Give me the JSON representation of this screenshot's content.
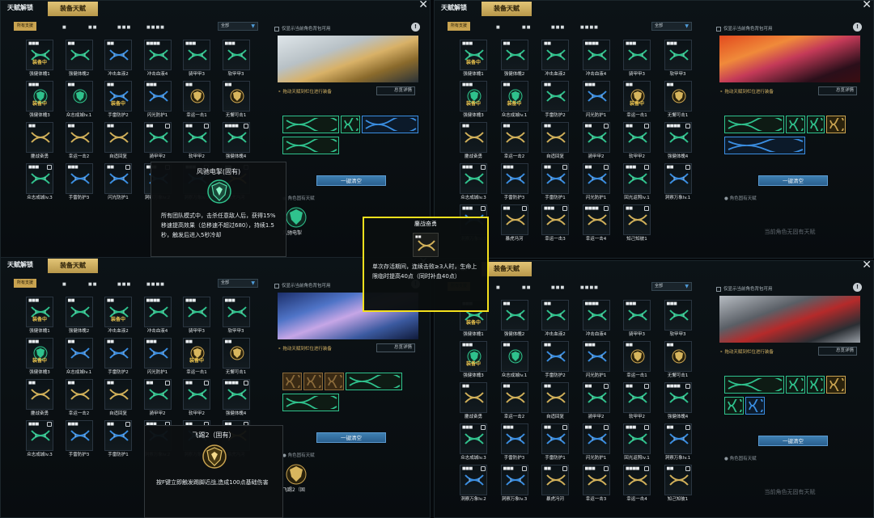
{
  "colors": {
    "accent_gold": "#c9a350",
    "equip_yellow": "#e7c04d",
    "helix_green": "#2fc28d",
    "helix_blue": "#3a8ee2",
    "highlight_box": "#f4e01d"
  },
  "common": {
    "tab_talent": "天赋解锁",
    "tab_equip": "装备天赋",
    "filter_all": "所有支援",
    "dropdown_value": "全部",
    "only_show_label": "仅显示当前角色背包可用",
    "help_glyph": "!",
    "drag_hint": "拖动天赋到栏位进行装备",
    "detail_button": "总览详情",
    "clear_button": "一键清空",
    "innate_title": "角色固有天赋",
    "innate_empty": "当前角色无固有天赋",
    "equipped_badge": "装备中",
    "close_glyph": "✕"
  },
  "panels": [
    {
      "cells": [
        {
          "label": "强健体魄1",
          "icon": "helix-green",
          "dots": "■■■",
          "equipped": true,
          "lock": false
        },
        {
          "label": "强健体魄2",
          "icon": "helix-green",
          "dots": "■■",
          "equipped": false,
          "lock": false
        },
        {
          "label": "冲击血液2",
          "icon": "helix-blue",
          "dots": "■■",
          "equipped": false,
          "lock": false
        },
        {
          "label": "冲击血液4",
          "icon": "helix-green",
          "dots": "■■■■",
          "equipped": false,
          "lock": false
        },
        {
          "label": "骑甲甲3",
          "icon": "helix-green",
          "dots": "■■■",
          "equipped": false,
          "lock": false
        },
        {
          "label": "软甲甲3",
          "icon": "helix-green",
          "dots": "■■■",
          "equipped": false,
          "lock": false
        },
        {
          "label": "强健体魄3",
          "icon": "shield-green",
          "dots": "■■■",
          "equipped": true,
          "lock": false
        },
        {
          "label": "众志成城lv.1",
          "icon": "shield-green",
          "dots": "■■",
          "equipped": false,
          "lock": false
        },
        {
          "label": "手雷防护2",
          "icon": "helix-blue",
          "dots": "■■",
          "equipped": true,
          "lock": false
        },
        {
          "label": "闪光防护1",
          "icon": "helix-blue",
          "dots": "■■■",
          "equipped": false,
          "lock": false
        },
        {
          "label": "幸运一击1",
          "icon": "shield-gold",
          "dots": "■■",
          "equipped": false,
          "lock": false
        },
        {
          "label": "无懈可击1",
          "icon": "shield-gold",
          "dots": "■■",
          "equipped": false,
          "lock": false
        },
        {
          "label": "鏖战奋勇",
          "icon": "helix-gold",
          "dots": "■■",
          "equipped": false,
          "lock": false
        },
        {
          "label": "幸运一击2",
          "icon": "helix-gold",
          "dots": "■■",
          "equipped": false,
          "lock": false
        },
        {
          "label": "自适回复",
          "icon": "helix-gold",
          "dots": "■■",
          "equipped": false,
          "lock": false
        },
        {
          "label": "骑甲甲2",
          "icon": "helix-green",
          "dots": "■■",
          "equipped": false,
          "lock": true
        },
        {
          "label": "软甲甲2",
          "icon": "helix-green",
          "dots": "■■",
          "equipped": false,
          "lock": true
        },
        {
          "label": "强健体魄4",
          "icon": "helix-green",
          "dots": "■■■■",
          "equipped": false,
          "lock": true
        },
        {
          "label": "众志成城lv.3",
          "icon": "helix-green",
          "dots": "■■■",
          "equipped": false,
          "lock": true
        },
        {
          "label": "手雷防护3",
          "icon": "helix-blue",
          "dots": "■■■",
          "equipped": false,
          "lock": false
        },
        {
          "label": "闪光防护1",
          "icon": "helix-blue",
          "dots": "■■",
          "equipped": false,
          "lock": true
        },
        {
          "label": "洞察万象lv.2",
          "icon": "helix-blue",
          "dots": "■■■",
          "equipped": false,
          "lock": true
        },
        {
          "label": "洞察万象lv.3",
          "icon": "helix-blue",
          "dots": "■■■",
          "equipped": false,
          "lock": true
        },
        {
          "label": "暴虎冯河",
          "icon": "helix-gold",
          "dots": "■■",
          "equipped": false,
          "lock": true
        }
      ],
      "tooltip": {
        "title": "风驰电掣(固有)",
        "body": "所有团队模式中，击杀任意敌人后，获得15%移速提高效果（总移速不超过680），持续1.5秒，触发后进入5秒冷却"
      },
      "innate_caption": "风驰电掣"
    },
    {
      "cells": [
        {
          "label": "强健体魄1",
          "icon": "helix-green",
          "dots": "■■■",
          "equipped": true,
          "lock": false
        },
        {
          "label": "强健体魄2",
          "icon": "helix-green",
          "dots": "■■",
          "equipped": false,
          "lock": false
        },
        {
          "label": "冲击血液2",
          "icon": "helix-green",
          "dots": "■■",
          "equipped": false,
          "lock": false
        },
        {
          "label": "冲击血液4",
          "icon": "helix-green",
          "dots": "■■■■",
          "equipped": false,
          "lock": false
        },
        {
          "label": "骑甲甲3",
          "icon": "helix-green",
          "dots": "■■■",
          "equipped": false,
          "lock": false
        },
        {
          "label": "软甲甲3",
          "icon": "helix-green",
          "dots": "■■■",
          "equipped": false,
          "lock": false
        },
        {
          "label": "强健体魄3",
          "icon": "shield-green",
          "dots": "■■■",
          "equipped": true,
          "lock": false
        },
        {
          "label": "众志成城lv.1",
          "icon": "shield-green",
          "dots": "■■",
          "equipped": true,
          "lock": false
        },
        {
          "label": "手雷防护2",
          "icon": "helix-green",
          "dots": "■■",
          "equipped": false,
          "lock": false
        },
        {
          "label": "闪光防护1",
          "icon": "helix-blue",
          "dots": "■■■",
          "equipped": false,
          "lock": false
        },
        {
          "label": "幸运一击1",
          "icon": "shield-gold",
          "dots": "■■",
          "equipped": true,
          "lock": false
        },
        {
          "label": "无懈可击1",
          "icon": "shield-gold",
          "dots": "■■",
          "equipped": false,
          "lock": false
        },
        {
          "label": "鏖战奋勇",
          "icon": "helix-gold",
          "dots": "■■",
          "equipped": false,
          "lock": false
        },
        {
          "label": "幸运一击2",
          "icon": "helix-gold",
          "dots": "■■",
          "equipped": false,
          "lock": false
        },
        {
          "label": "自适回复",
          "icon": "helix-gold",
          "dots": "■■",
          "equipped": false,
          "lock": false
        },
        {
          "label": "骑甲甲2",
          "icon": "helix-green",
          "dots": "■■",
          "equipped": false,
          "lock": true
        },
        {
          "label": "软甲甲2",
          "icon": "helix-green",
          "dots": "■■",
          "equipped": false,
          "lock": true
        },
        {
          "label": "强健体魄4",
          "icon": "helix-green",
          "dots": "■■■■",
          "equipped": false,
          "lock": true
        },
        {
          "label": "众志成城lv.3",
          "icon": "helix-green",
          "dots": "■■■",
          "equipped": false,
          "lock": true
        },
        {
          "label": "手雷防护3",
          "icon": "helix-blue",
          "dots": "■■■",
          "equipped": false,
          "lock": false
        },
        {
          "label": "手雷防护1",
          "icon": "helix-blue",
          "dots": "■■",
          "equipped": false,
          "lock": true
        },
        {
          "label": "闪光防护1",
          "icon": "helix-blue",
          "dots": "■■",
          "equipped": false,
          "lock": true
        },
        {
          "label": "回光返照lv.1",
          "icon": "helix-green",
          "dots": "■■■",
          "equipped": false,
          "lock": true
        },
        {
          "label": "洞察万象lv.1",
          "icon": "helix-blue",
          "dots": "■■",
          "equipped": false,
          "lock": true
        },
        {
          "label": "洞察万象lv.3",
          "icon": "helix-blue",
          "dots": "■■■",
          "equipped": false,
          "lock": true
        },
        {
          "label": "暴虎冯河",
          "icon": "helix-gold",
          "dots": "■■",
          "equipped": false,
          "lock": true
        },
        {
          "label": "幸运一击3",
          "icon": "helix-gold",
          "dots": "■■■",
          "equipped": false,
          "lock": true
        },
        {
          "label": "幸运一击4",
          "icon": "helix-gold",
          "dots": "■■■■",
          "equipped": false,
          "lock": true
        },
        {
          "label": "知己知彼1",
          "icon": "helix-gold",
          "dots": "■■",
          "equipped": false,
          "lock": true
        }
      ]
    },
    {
      "cells": [
        {
          "label": "强健体魄1",
          "icon": "helix-green",
          "dots": "■■■",
          "equipped": true,
          "lock": false
        },
        {
          "label": "强健体魄2",
          "icon": "helix-green",
          "dots": "■■",
          "equipped": false,
          "lock": false
        },
        {
          "label": "冲击血液2",
          "icon": "helix-green",
          "dots": "■■",
          "equipped": true,
          "lock": false
        },
        {
          "label": "冲击血液4",
          "icon": "helix-green",
          "dots": "■■■■",
          "equipped": false,
          "lock": false
        },
        {
          "label": "骑甲甲3",
          "icon": "helix-green",
          "dots": "■■■",
          "equipped": false,
          "lock": false
        },
        {
          "label": "软甲甲3",
          "icon": "helix-green",
          "dots": "■■■",
          "equipped": false,
          "lock": false
        },
        {
          "label": "强健体魄3",
          "icon": "shield-green",
          "dots": "■■■",
          "equipped": true,
          "lock": false
        },
        {
          "label": "众志成城lv.1",
          "icon": "helix-blue",
          "dots": "■■",
          "equipped": false,
          "lock": false
        },
        {
          "label": "手雷防护2",
          "icon": "helix-blue",
          "dots": "■■",
          "equipped": false,
          "lock": false
        },
        {
          "label": "闪光防护1",
          "icon": "helix-blue",
          "dots": "■■■",
          "equipped": false,
          "lock": false
        },
        {
          "label": "幸运一击1",
          "icon": "shield-gold",
          "dots": "■■",
          "equipped": true,
          "lock": false
        },
        {
          "label": "无懈可击1",
          "icon": "shield-gold",
          "dots": "■■",
          "equipped": false,
          "lock": false
        },
        {
          "label": "鏖战奋勇",
          "icon": "helix-gold",
          "dots": "■■",
          "equipped": false,
          "lock": false
        },
        {
          "label": "幸运一击2",
          "icon": "helix-gold",
          "dots": "■■",
          "equipped": false,
          "lock": false
        },
        {
          "label": "自适回复",
          "icon": "helix-gold",
          "dots": "■■",
          "equipped": false,
          "lock": false
        },
        {
          "label": "骑甲甲2",
          "icon": "helix-green",
          "dots": "■■",
          "equipped": false,
          "lock": true
        },
        {
          "label": "软甲甲2",
          "icon": "helix-green",
          "dots": "■■",
          "equipped": false,
          "lock": true
        },
        {
          "label": "强健体魄4",
          "icon": "helix-green",
          "dots": "■■■■",
          "equipped": false,
          "lock": true
        },
        {
          "label": "众志成城lv.3",
          "icon": "helix-green",
          "dots": "■■■",
          "equipped": false,
          "lock": true
        },
        {
          "label": "手雷防护3",
          "icon": "helix-blue",
          "dots": "■■■",
          "equipped": false,
          "lock": false
        },
        {
          "label": "手雷防护1",
          "icon": "helix-blue",
          "dots": "■■",
          "equipped": false,
          "lock": true
        },
        {
          "label": "洞察万象lv.2",
          "icon": "helix-blue",
          "dots": "■■■",
          "equipped": false,
          "lock": true
        },
        {
          "label": "洞察万象lv.1",
          "icon": "helix-blue",
          "dots": "■■",
          "equipped": false,
          "lock": true
        },
        {
          "label": "暴虎冯河",
          "icon": "helix-gold",
          "dots": "■■",
          "equipped": false,
          "lock": true
        }
      ],
      "tooltip": {
        "title": "飞踢2（固有）",
        "body": "按F键立即触发踢脚近战,造成100点基础伤害"
      },
      "innate_caption": "飞踢2（固"
    },
    {
      "cells": [
        {
          "label": "强健体魄1",
          "icon": "helix-green",
          "dots": "■■■",
          "equipped": true,
          "lock": false
        },
        {
          "label": "强健体魄2",
          "icon": "helix-green",
          "dots": "■■",
          "equipped": false,
          "lock": false
        },
        {
          "label": "冲击血液2",
          "icon": "helix-green",
          "dots": "■■",
          "equipped": false,
          "lock": false
        },
        {
          "label": "冲击血液4",
          "icon": "helix-green",
          "dots": "■■■■",
          "equipped": false,
          "lock": false
        },
        {
          "label": "骑甲甲3",
          "icon": "helix-green",
          "dots": "■■■",
          "equipped": false,
          "lock": false
        },
        {
          "label": "软甲甲3",
          "icon": "helix-green",
          "dots": "■■■",
          "equipped": false,
          "lock": false
        },
        {
          "label": "强健体魄3",
          "icon": "shield-green",
          "dots": "■■■",
          "equipped": true,
          "lock": false
        },
        {
          "label": "众志成城lv.1",
          "icon": "shield-green",
          "dots": "■■",
          "equipped": false,
          "lock": false
        },
        {
          "label": "手雷防护2",
          "icon": "helix-blue",
          "dots": "■■",
          "equipped": false,
          "lock": false
        },
        {
          "label": "闪光防护1",
          "icon": "helix-blue",
          "dots": "■■■",
          "equipped": false,
          "lock": false
        },
        {
          "label": "幸运一击1",
          "icon": "shield-gold",
          "dots": "■■",
          "equipped": false,
          "lock": false
        },
        {
          "label": "无懈可击1",
          "icon": "shield-gold",
          "dots": "■■",
          "equipped": false,
          "lock": false
        },
        {
          "label": "鏖战奋勇",
          "icon": "helix-gold",
          "dots": "■■",
          "equipped": false,
          "lock": false
        },
        {
          "label": "幸运一击2",
          "icon": "helix-gold",
          "dots": "■■",
          "equipped": false,
          "lock": false
        },
        {
          "label": "自适回复",
          "icon": "helix-gold",
          "dots": "■■",
          "equipped": false,
          "lock": false
        },
        {
          "label": "骑甲甲2",
          "icon": "helix-green",
          "dots": "■■",
          "equipped": false,
          "lock": true
        },
        {
          "label": "软甲甲2",
          "icon": "helix-green",
          "dots": "■■",
          "equipped": false,
          "lock": true
        },
        {
          "label": "强健体魄4",
          "icon": "helix-green",
          "dots": "■■■■",
          "equipped": false,
          "lock": true
        },
        {
          "label": "众志成城lv.3",
          "icon": "helix-green",
          "dots": "■■■",
          "equipped": false,
          "lock": true
        },
        {
          "label": "手雷防护3",
          "icon": "helix-blue",
          "dots": "■■■",
          "equipped": false,
          "lock": false
        },
        {
          "label": "手雷防护1",
          "icon": "helix-blue",
          "dots": "■■",
          "equipped": false,
          "lock": true
        },
        {
          "label": "闪光防护1",
          "icon": "helix-blue",
          "dots": "■■",
          "equipped": false,
          "lock": true
        },
        {
          "label": "回光返照lv.1",
          "icon": "helix-green",
          "dots": "■■■",
          "equipped": false,
          "lock": true
        },
        {
          "label": "洞察万象lv.1",
          "icon": "helix-blue",
          "dots": "■■",
          "equipped": false,
          "lock": true
        },
        {
          "label": "洞察万象lv.2",
          "icon": "helix-blue",
          "dots": "■■■",
          "equipped": false,
          "lock": true
        },
        {
          "label": "洞察万象lv.3",
          "icon": "helix-blue",
          "dots": "■■■",
          "equipped": false,
          "lock": true
        },
        {
          "label": "暴虎冯河",
          "icon": "helix-gold",
          "dots": "■■",
          "equipped": false,
          "lock": true
        },
        {
          "label": "幸运一击3",
          "icon": "helix-gold",
          "dots": "■■■",
          "equipped": false,
          "lock": true
        },
        {
          "label": "幸运一击4",
          "icon": "helix-gold",
          "dots": "■■■■",
          "equipped": false,
          "lock": true
        },
        {
          "label": "知己知彼1",
          "icon": "helix-gold",
          "dots": "■■",
          "equipped": false,
          "lock": true
        }
      ]
    }
  ],
  "highlight_tooltip": {
    "title": "鏖战奋勇",
    "body": "单次存活期间，连续击败≥3人时，生命上限临时提高40点（同时补血40点）"
  }
}
